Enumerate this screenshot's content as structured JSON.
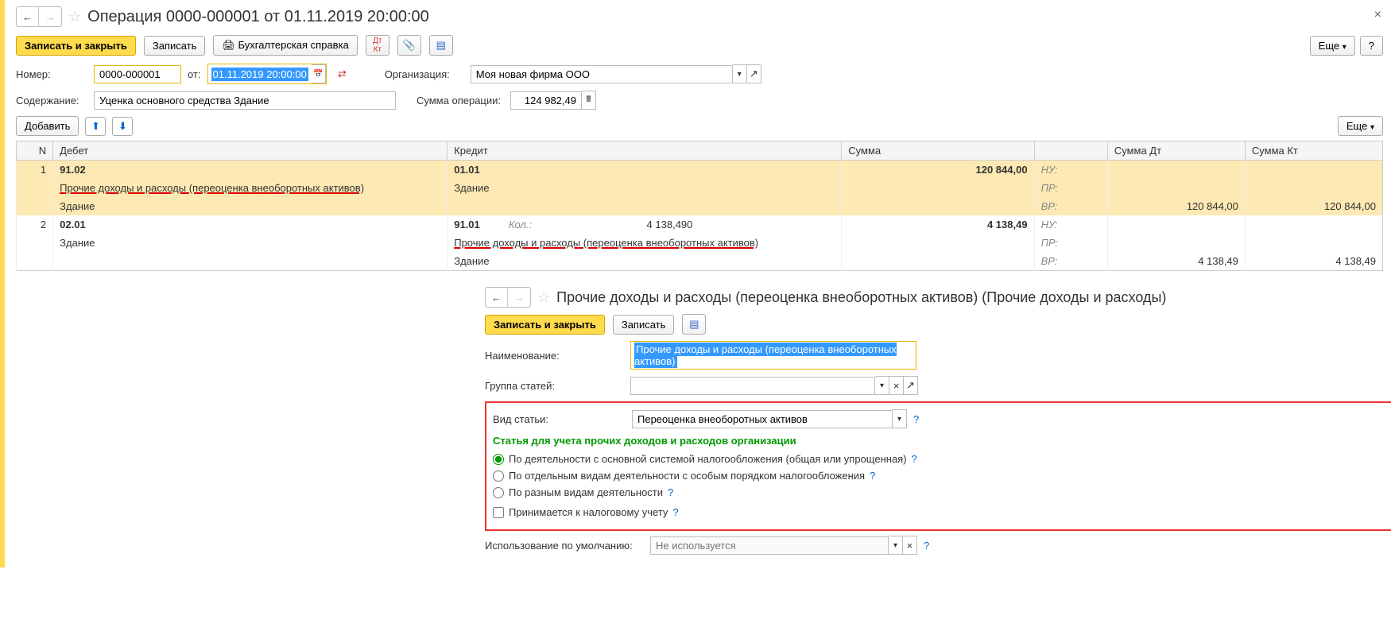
{
  "header": {
    "title": "Операция 0000-000001 от 01.11.2019 20:00:00"
  },
  "toolbar": {
    "save_close": "Записать и закрыть",
    "save": "Записать",
    "print_ref": "Бухгалтерская справка",
    "more": "Еще",
    "help": "?"
  },
  "form": {
    "number_label": "Номер:",
    "number": "0000-000001",
    "from_label": "от:",
    "date": "01.11.2019 20:00:00",
    "org_label": "Организация:",
    "org": "Моя новая фирма ООО",
    "desc_label": "Содержание:",
    "desc": "Уценка основного средства Здание",
    "sum_label": "Сумма операции:",
    "sum": "124 982,49"
  },
  "subtoolbar": {
    "add": "Добавить",
    "more": "Еще"
  },
  "table": {
    "col_n": "N",
    "col_debit": "Дебет",
    "col_credit": "Кредит",
    "col_sum": "Сумма",
    "col_sum_dt": "Сумма Дт",
    "col_sum_kt": "Сумма Кт"
  },
  "rows": [
    {
      "n": "1",
      "debit_acc": "91.02",
      "debit_l1": "Прочие доходы и расходы (переоценка внеоборотных активов)",
      "debit_l2": "Здание",
      "credit_acc": "01.01",
      "credit_l1": "Здание",
      "credit_qty": "",
      "credit_qtyval": "",
      "sum": "120 844,00",
      "nu": "НУ:",
      "pr": "ПР:",
      "vr": "ВР:",
      "dt_vr": "120 844,00",
      "kt_vr": "120 844,00"
    },
    {
      "n": "2",
      "debit_acc": "02.01",
      "debit_l1": "Здание",
      "debit_l2": "",
      "credit_acc": "91.01",
      "credit_l1": "Прочие доходы и расходы (переоценка внеоборотных активов)",
      "credit_l2": "Здание",
      "credit_qty": "Кол.:",
      "credit_qtyval": "4 138,490",
      "sum": "4 138,49",
      "nu": "НУ:",
      "pr": "ПР:",
      "vr": "ВР:",
      "dt_vr": "4 138,49",
      "kt_vr": "4 138,49"
    }
  ],
  "sub": {
    "title": "Прочие доходы и расходы (переоценка внеоборотных активов) (Прочие доходы и расходы)",
    "save_close": "Записать и закрыть",
    "save": "Записать",
    "name_label": "Наименование:",
    "name": "Прочие доходы и расходы (переоценка внеоборотных активов)",
    "group_label": "Группа статей:",
    "kind_label": "Вид статьи:",
    "kind": "Переоценка внеоборотных активов",
    "section_h": "Статья для учета прочих доходов и расходов организации",
    "r1": "По деятельности с основной системой налогообложения (общая или упрощенная)",
    "r2": "По отдельным видам деятельности с особым порядком налогообложения",
    "r3": "По разным видам деятельности",
    "chk": "Принимается к налоговому учету",
    "use_label": "Использование по умолчанию:",
    "use_ph": "Не используется",
    "q": "?"
  }
}
